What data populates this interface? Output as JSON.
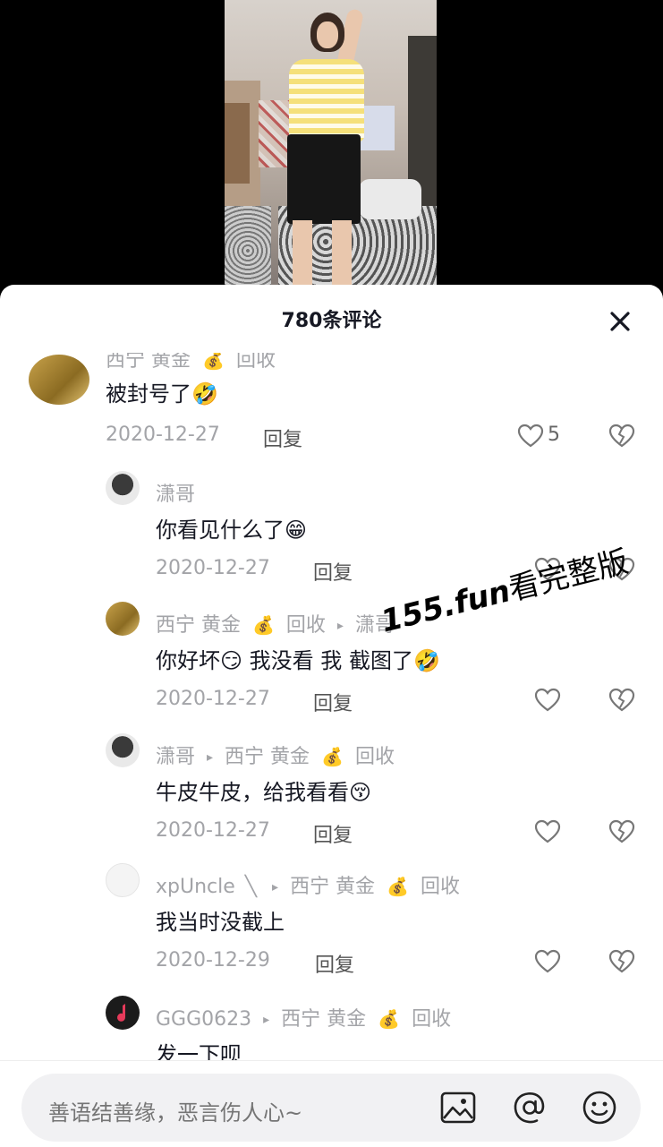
{
  "sheet": {
    "title": "780条评论"
  },
  "comments": [
    {
      "avatar": "gold-bars-avatar",
      "user": [
        "西宁",
        "黄金",
        "💰",
        "回收"
      ],
      "text": "被封号了",
      "emoji": "🤣",
      "date": "2020-12-27",
      "reply_label": "回复",
      "likes": "5"
    },
    {
      "avatar": "dark-avatar",
      "user": [
        "潇哥"
      ],
      "text": "你看见什么了",
      "emoji": "😁",
      "date": "2020-12-27",
      "reply_label": "回复"
    },
    {
      "avatar": "gold-bars-avatar",
      "user": [
        "西宁 黄金",
        "💰",
        "回收",
        "▸",
        "潇哥"
      ],
      "text_parts": [
        "你好坏",
        "😏",
        "我没看 我",
        "截图了",
        "🤣"
      ],
      "date": "2020-12-27",
      "reply_label": "回复"
    },
    {
      "avatar": "dark-avatar",
      "user": [
        "潇哥",
        "▸",
        "西宁 黄金",
        "💰",
        "回收"
      ],
      "text": "牛皮牛皮，给我看看",
      "emoji": "😚",
      "date": "2020-12-27",
      "reply_label": "回复"
    },
    {
      "avatar": "white-avatar",
      "user": [
        "xpUncle",
        "╲",
        "▸",
        "西宁 黄金",
        "💰",
        "回收"
      ],
      "text": "我当时没截上",
      "date": "2020-12-29",
      "reply_label": "回复"
    },
    {
      "avatar": "music-avatar",
      "user": [
        "GGG0623",
        "▸",
        "西宁 黄金",
        "💰",
        "回收"
      ],
      "text": "发一下呗"
    }
  ],
  "watermark": {
    "url": "155.fun",
    "text": "看完整版"
  },
  "input": {
    "placeholder": "善语结善缘，恶言伤人心~"
  },
  "icons": [
    "close-icon",
    "heart-icon",
    "broken-heart-icon",
    "image-icon",
    "at-icon",
    "emoji-icon"
  ]
}
